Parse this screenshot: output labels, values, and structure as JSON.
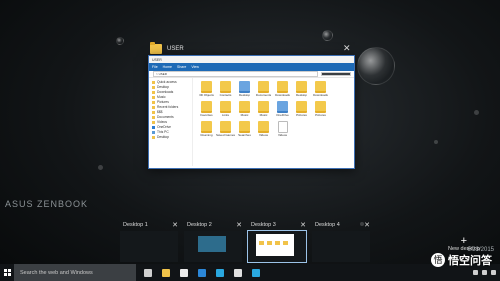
{
  "brand": "ASUS ZENBOOK",
  "window": {
    "title": "USER",
    "explorer_title": "USER",
    "ribbon_tabs": [
      "File",
      "Home",
      "Share",
      "View"
    ],
    "address": "> USER",
    "nav_items": [
      {
        "label": "Quick access",
        "icon": "star-icon"
      },
      {
        "label": "Desktop",
        "icon": "folder-icon"
      },
      {
        "label": "Downloads",
        "icon": "folder-icon"
      },
      {
        "label": "Music",
        "icon": "folder-icon"
      },
      {
        "label": "Pictures",
        "icon": "folder-icon"
      },
      {
        "label": "Recent folders",
        "icon": "folder-icon"
      },
      {
        "label": "$$$",
        "icon": "folder-icon"
      },
      {
        "label": "Documents",
        "icon": "folder-icon"
      },
      {
        "label": "Videos",
        "icon": "folder-icon"
      },
      {
        "label": "OneDrive",
        "icon": "onedrive-icon"
      },
      {
        "label": "This PC",
        "icon": "pc-icon"
      },
      {
        "label": "Desktop",
        "icon": "folder-icon"
      }
    ],
    "files": [
      {
        "label": "3D Objects",
        "kind": "folder"
      },
      {
        "label": "Contacts",
        "kind": "folder"
      },
      {
        "label": "Desktop",
        "kind": "blue"
      },
      {
        "label": "Documents",
        "kind": "folder"
      },
      {
        "label": "Downloads",
        "kind": "folder"
      },
      {
        "label": "Desktop",
        "kind": "folder"
      },
      {
        "label": "Downloads",
        "kind": "folder"
      },
      {
        "label": "",
        "kind": "none"
      },
      {
        "label": "Favorites",
        "kind": "folder"
      },
      {
        "label": "Links",
        "kind": "folder"
      },
      {
        "label": "Music",
        "kind": "folder"
      },
      {
        "label": "Music",
        "kind": "folder"
      },
      {
        "label": "OneDrive",
        "kind": "blue"
      },
      {
        "label": "Pictures",
        "kind": "folder"
      },
      {
        "label": "Pictures",
        "kind": "folder"
      },
      {
        "label": "",
        "kind": "none"
      },
      {
        "label": "Roaming",
        "kind": "folder"
      },
      {
        "label": "Saved Games",
        "kind": "folder"
      },
      {
        "label": "Searches",
        "kind": "folder"
      },
      {
        "label": "Videos",
        "kind": "folder"
      },
      {
        "label": "Videos",
        "kind": "doc"
      }
    ]
  },
  "desktops": [
    {
      "label": "Desktop 1",
      "close": "✕"
    },
    {
      "label": "Desktop 2",
      "close": "✕"
    },
    {
      "label": "Desktop 3",
      "close": "✕"
    },
    {
      "label": "Desktop 4",
      "close": "✕"
    }
  ],
  "new_desktop": {
    "plus": "+",
    "label": "New desktop"
  },
  "taskbar": {
    "search_placeholder": "Search the web and Windows",
    "icons": [
      {
        "name": "task-view-icon",
        "color": "#d0d0d0"
      },
      {
        "name": "file-explorer-icon",
        "color": "#f1c34a"
      },
      {
        "name": "store-icon",
        "color": "#ececec"
      },
      {
        "name": "edge-icon",
        "color": "#2b87d8"
      },
      {
        "name": "skype-icon",
        "color": "#2aa8e0"
      },
      {
        "name": "media-icon",
        "color": "#e0e0e0"
      },
      {
        "name": "skype-icon",
        "color": "#2aa8e0"
      }
    ]
  },
  "date": "6/23/2015",
  "watermark": "悟空问答"
}
